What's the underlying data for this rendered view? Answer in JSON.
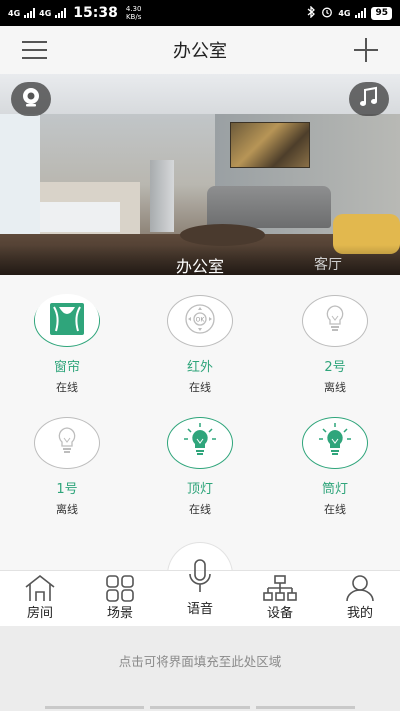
{
  "status_bar": {
    "signal1": "4G",
    "signal2": "4G",
    "time": "15:38",
    "speed_value": "4.30",
    "speed_unit": "KB/s",
    "network_right": "4G",
    "battery": "95"
  },
  "header": {
    "title": "办公室"
  },
  "banner": {
    "current_room": "办公室",
    "next_room": "客厅"
  },
  "devices": [
    {
      "name": "窗帘",
      "status": "在线",
      "icon": "curtain-icon",
      "state": "on"
    },
    {
      "name": "红外",
      "status": "在线",
      "icon": "remote-control-icon",
      "state": "neutral"
    },
    {
      "name": "2号",
      "status": "离线",
      "icon": "bulb-icon",
      "state": "off"
    },
    {
      "name": "1号",
      "status": "离线",
      "icon": "bulb-icon",
      "state": "off"
    },
    {
      "name": "顶灯",
      "status": "在线",
      "icon": "bulb-lit-icon",
      "state": "on"
    },
    {
      "name": "筒灯",
      "status": "在线",
      "icon": "bulb-lit-icon",
      "state": "on"
    }
  ],
  "nav": {
    "room": "房间",
    "scene": "场景",
    "voice": "语音",
    "device": "设备",
    "mine": "我的"
  },
  "fill_hint": "点击可将界面填充至此处区域",
  "colors": {
    "accent": "#2fa57b"
  }
}
